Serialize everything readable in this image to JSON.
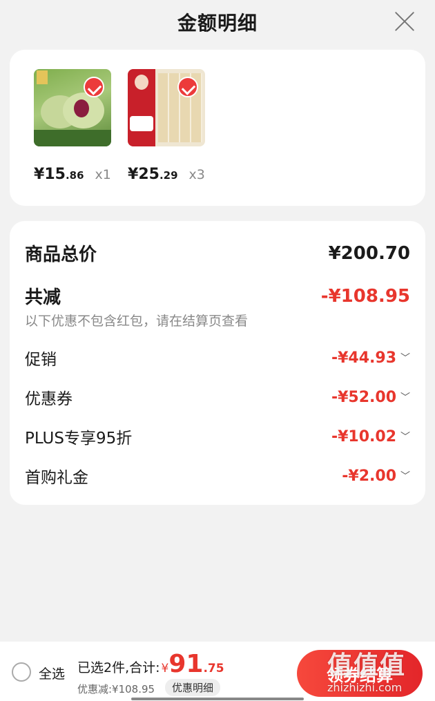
{
  "header": {
    "title": "金额明细"
  },
  "products": [
    {
      "price_int": "15",
      "price_dec": ".86",
      "qty": "x1"
    },
    {
      "price_int": "25",
      "price_dec": ".29",
      "qty": "x3"
    }
  ],
  "currency": "¥",
  "summary": {
    "total_label": "商品总价",
    "total_value": "¥200.70",
    "reduce_label": "共减",
    "reduce_value": "-¥108.95",
    "note": "以下优惠不包含红包，请在结算页查看",
    "items": [
      {
        "label": "促销",
        "value": "-¥44.93"
      },
      {
        "label": "优惠券",
        "value": "-¥52.00"
      },
      {
        "label": "PLUS专享95折",
        "value": "-¥10.02"
      },
      {
        "label": "首购礼金",
        "value": "-¥2.00"
      }
    ]
  },
  "bottom": {
    "select_all": "全选",
    "selected_label": "已选2件,合计:",
    "yen": "¥",
    "total_int": "91",
    "total_dec": ".75",
    "discount": "优惠减:¥108.95",
    "detail_label": "优惠明细",
    "checkout_label": "领券结算"
  },
  "watermark": {
    "big": "值值值",
    "small": "zhizhizhi.com"
  },
  "icons": {
    "close": "close-icon",
    "check": "check-icon",
    "chevron": "chevron-down-icon"
  },
  "colors": {
    "accent": "#e8362d"
  }
}
